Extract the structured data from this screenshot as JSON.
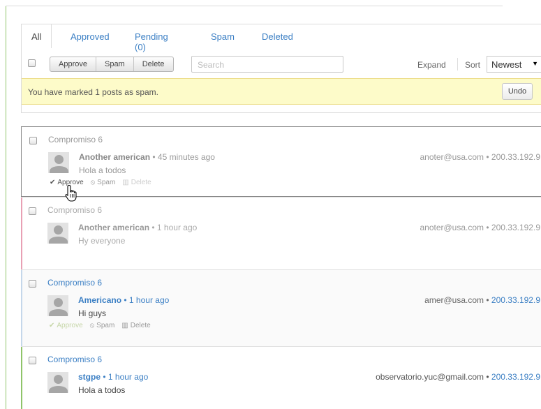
{
  "tabs": [
    {
      "label": "All"
    },
    {
      "label": "Approved"
    },
    {
      "label": "Pending (0)"
    },
    {
      "label": "Spam"
    },
    {
      "label": "Deleted"
    }
  ],
  "toolbar": {
    "approve": "Approve",
    "spam": "Spam",
    "delete": "Delete",
    "search_placeholder": "Search",
    "expand": "Expand",
    "sort_label": "Sort",
    "sort_value": "Newest"
  },
  "notice": {
    "text": "You have marked 1 posts as spam.",
    "undo": "Undo"
  },
  "posts": [
    {
      "thread": "Compromiso 6",
      "author": "Another american",
      "time": "45 minutes ago",
      "message": "Hola a todos",
      "email": "anoter@usa.com",
      "ip": "200.33.192.9",
      "actions": [
        "Approve",
        "Spam",
        "Delete"
      ]
    },
    {
      "thread": "Compromiso 6",
      "author": "Another american",
      "time": "1 hour ago",
      "message": "Hy everyone",
      "email": "anoter@usa.com",
      "ip": "200.33.192.9"
    },
    {
      "thread": "Compromiso 6",
      "author": "Americano",
      "time": "1 hour ago",
      "message": "Hi guys",
      "email": "amer@usa.com",
      "ip": "200.33.192.9",
      "actions": [
        "Approve",
        "Spam",
        "Delete"
      ]
    },
    {
      "thread": "Compromiso 6",
      "author": "stgpe",
      "time": "1 hour ago",
      "message": "Hola a todos",
      "email": "observatorio.yuc@gmail.com",
      "ip": "200.33.192.9"
    }
  ],
  "separator": "•",
  "colors": {
    "link": "#3b7fc4",
    "notice_bg": "#fdfbc9",
    "spam_bar": "#e8a0b4",
    "pending_bar": "#c5d7ea",
    "approved_bar": "#8fc46a"
  }
}
